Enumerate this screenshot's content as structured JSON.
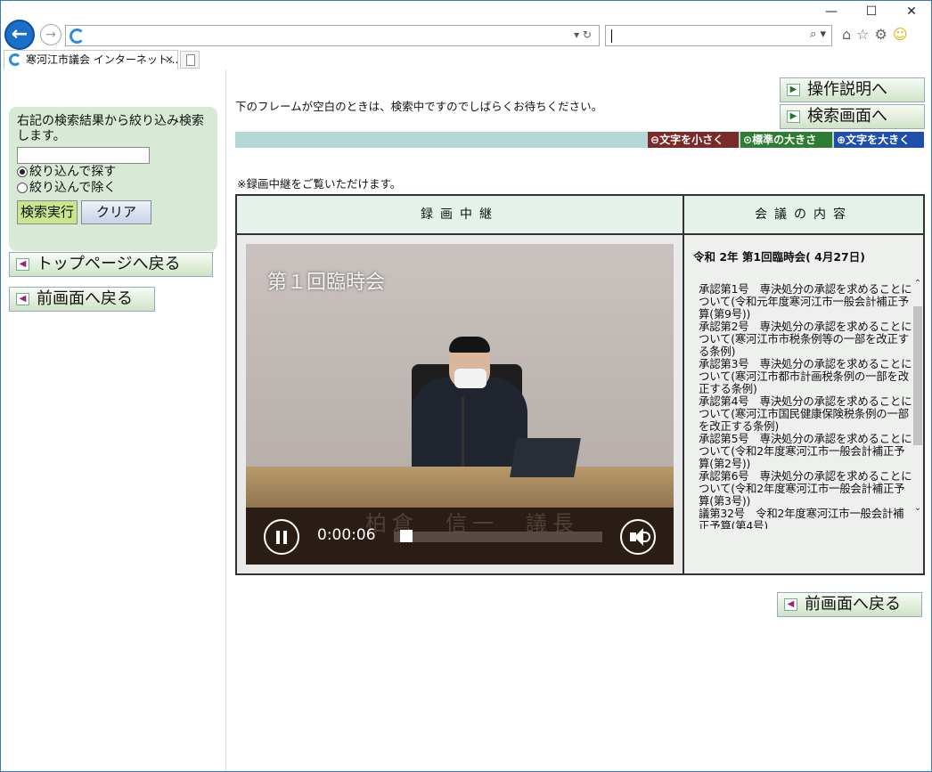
{
  "window": {
    "controls": [
      "—",
      "☐",
      "✕"
    ]
  },
  "toolbar": {
    "address_value": "",
    "search_value": ""
  },
  "tab": {
    "title": "寒河江市議会 インターネット...",
    "close": "✕"
  },
  "left": {
    "filter_text": "右記の検索結果から絞り込み検索します。",
    "filter_input": "",
    "radio_include": "絞り込んで探す",
    "radio_exclude": "絞り込んで除く",
    "exec_button": "検索実行",
    "clear_button": "クリア",
    "top_page_button": "トップページへ戻る",
    "prev_page_button": "前画面へ戻る"
  },
  "main": {
    "notice": "下のフレームが空白のときは、検索中ですのでしばらくお待ちください。",
    "help_button": "操作説明へ",
    "search_screen_button": "検索画面へ",
    "font_small": "文字を小さく",
    "font_normal": "標準の大きさ",
    "font_large": "文字を大きく",
    "note": "※録画中継をご覧いただけます。",
    "col_video": "録画中継",
    "col_meeting": "会議の内容",
    "video": {
      "overlay_title": "第１回臨時会",
      "nameplate": "柏倉　信一　議長",
      "time": "0:00:06",
      "progress": 0.03
    },
    "meeting_title": "令和 2年 第1回臨時会( 4月27日)",
    "agenda": [
      "承認第1号　専決処分の承認を求めることについて(令和元年度寒河江市一般会計補正予算(第9号))",
      "承認第2号　専決処分の承認を求めることについて(寒河江市市税条例等の一部を改正する条例)",
      "承認第3号　専決処分の承認を求めることについて(寒河江市都市計画税条例の一部を改正する条例)",
      "承認第4号　専決処分の承認を求めることについて(寒河江市国民健康保険税条例の一部を改正する条例)",
      "承認第5号　専決処分の承認を求めることについて(令和2年度寒河江市一般会計補正予算(第2号))",
      "承認第6号　専決処分の承認を求めることについて(令和2年度寒河江市一般会計補正予算(第3号))",
      "議第32号　令和2年度寒河江市一般会計補正予算(第4号)"
    ],
    "back_button": "前画面へ戻る"
  }
}
